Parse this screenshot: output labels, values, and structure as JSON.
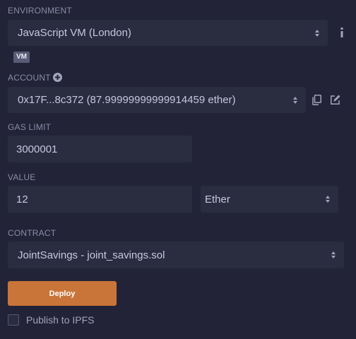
{
  "environment": {
    "label": "ENVIRONMENT",
    "value": "JavaScript VM (London)",
    "badge": "VM"
  },
  "account": {
    "label": "ACCOUNT",
    "value": "0x17F...8c372 (87.99999999999914459 ether)"
  },
  "gas_limit": {
    "label": "GAS LIMIT",
    "value": "3000001"
  },
  "value": {
    "label": "VALUE",
    "amount": "12",
    "unit": "Ether"
  },
  "contract": {
    "label": "CONTRACT",
    "value": "JointSavings - joint_savings.sol"
  },
  "deploy": {
    "label": "Deploy"
  },
  "publish": {
    "label": "Publish to IPFS",
    "checked": false
  },
  "colors": {
    "background": "#222336",
    "field": "#2a2c3f",
    "deploy": "#c97539",
    "text": "#a2a3bd"
  }
}
